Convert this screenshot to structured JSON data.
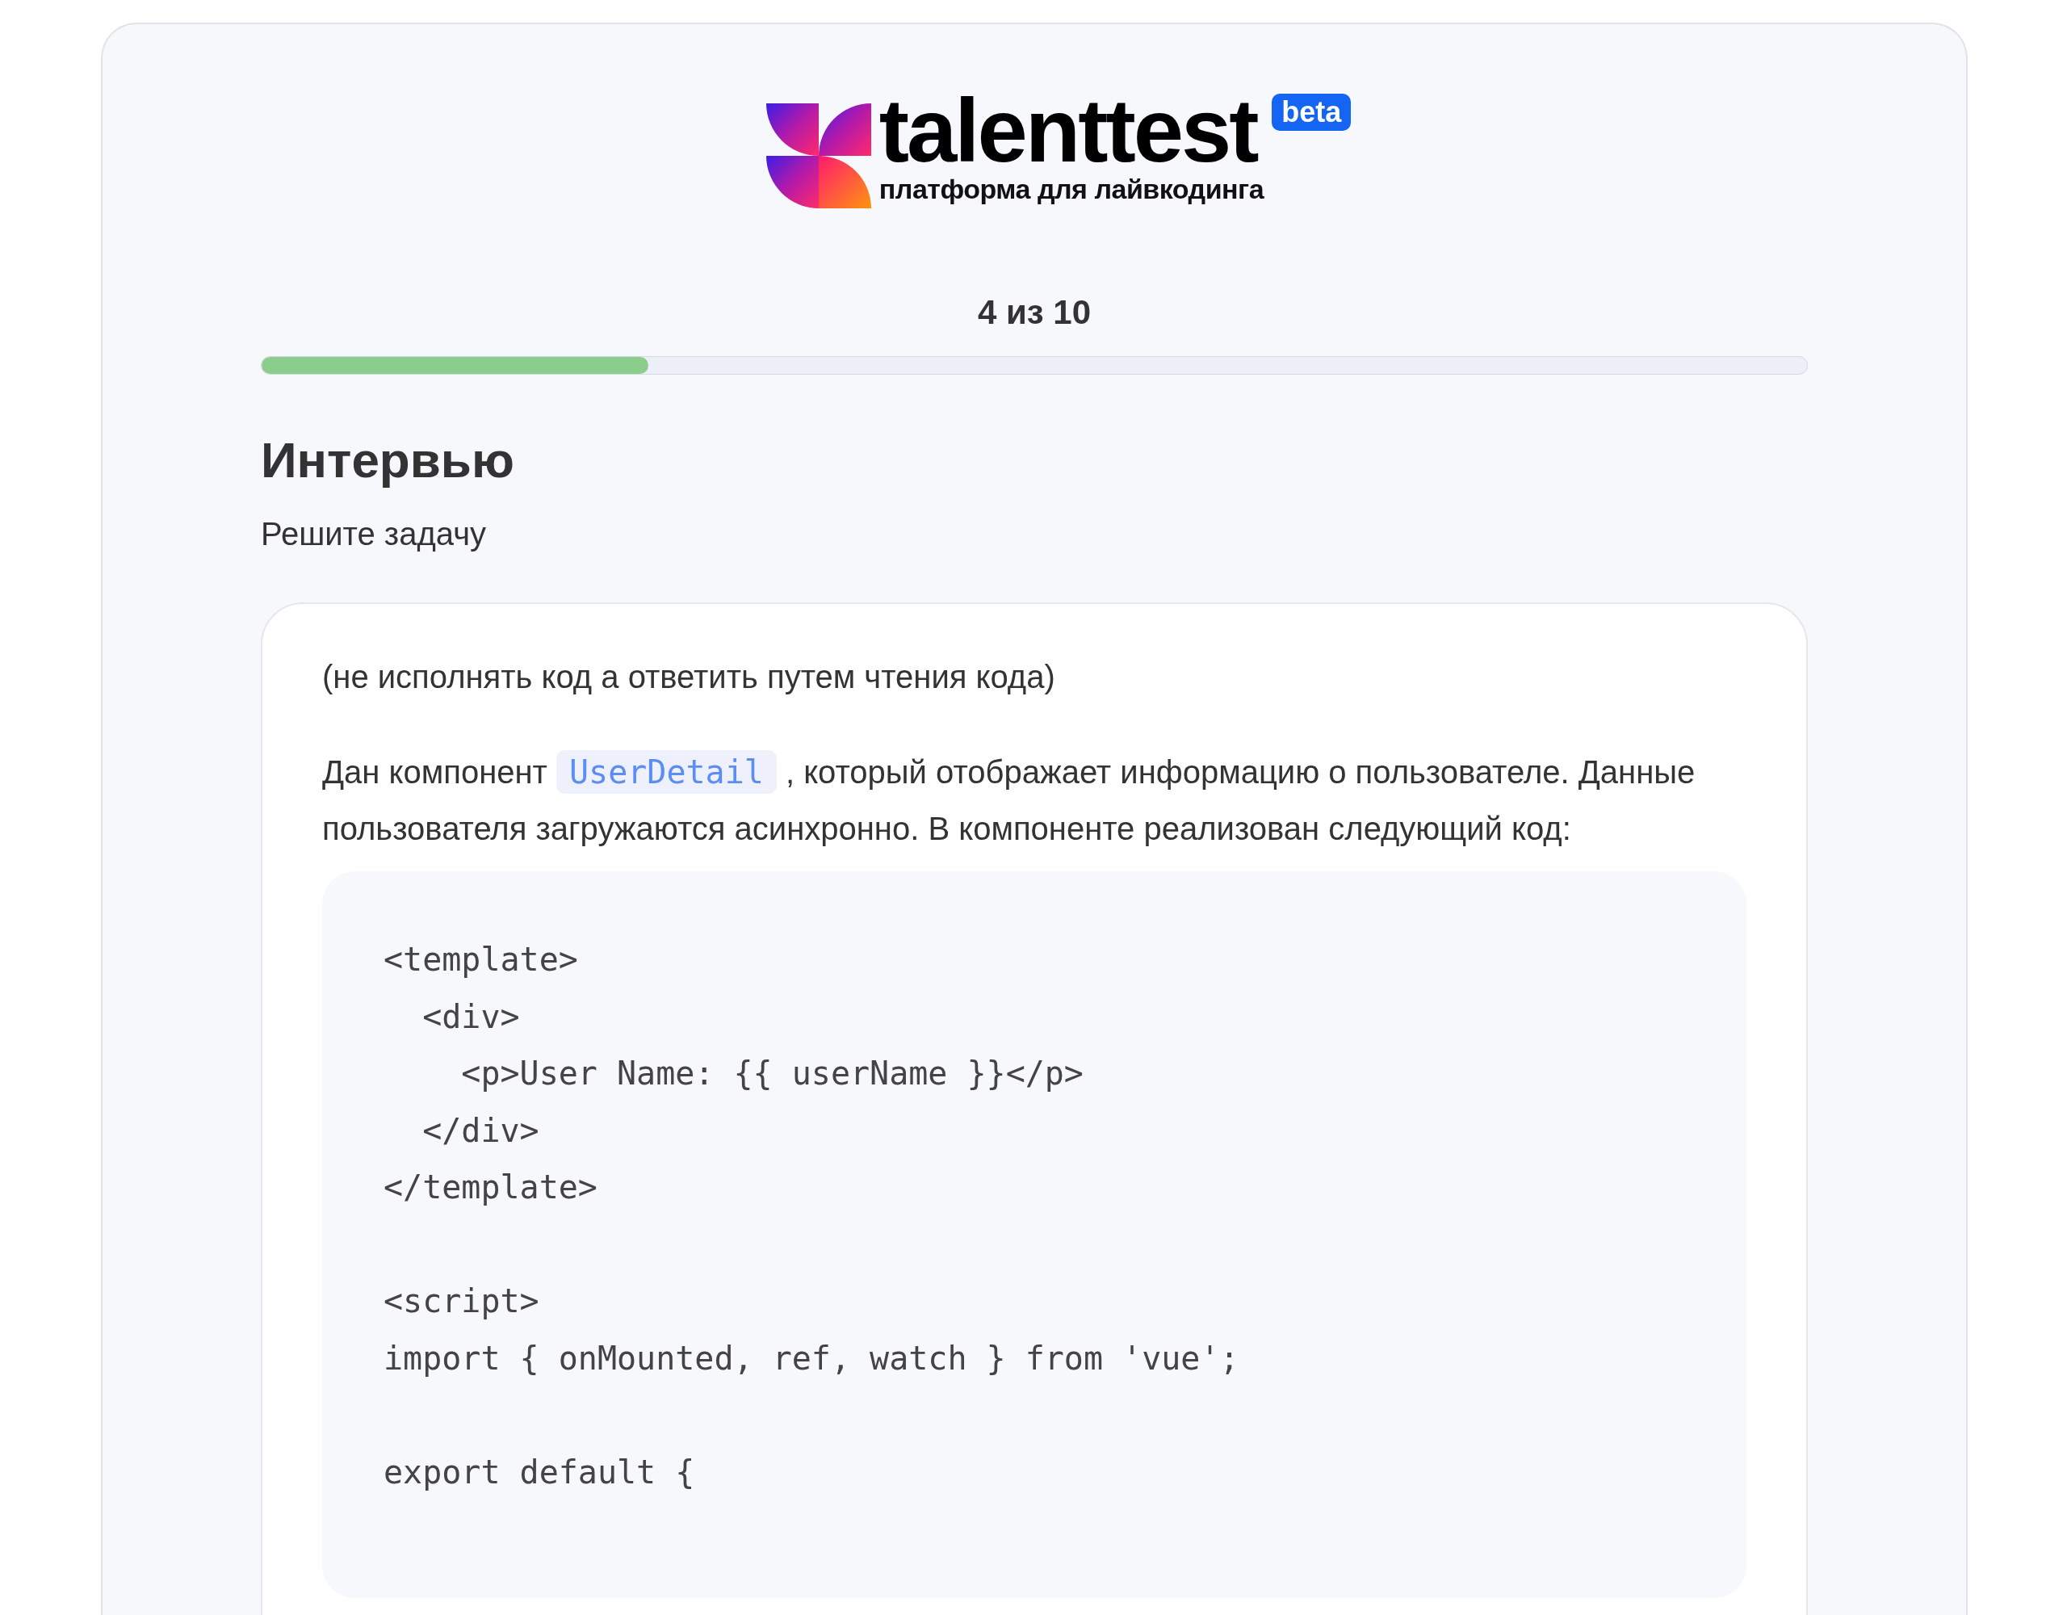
{
  "logo": {
    "name": "talenttest",
    "tagline": "платформа для лайвкодинга",
    "badge": "beta"
  },
  "progress": {
    "label": "4 из 10",
    "level": 0.25
  },
  "section": {
    "title": "Интервью",
    "subtitle": "Решите задачу"
  },
  "question": {
    "note": "(не исполнять код а ответить путем чтения кода)",
    "paragraph": [
      {
        "kind": "text",
        "text": "Дан компонент "
      },
      {
        "kind": "code",
        "text": "UserDetail"
      },
      {
        "kind": "text",
        "text": " , который отображает информацию о пользователе. Данные пользователя загружаются асинхронно. В компоненте реализован следующий код:"
      }
    ],
    "code": "<template>\n  <div>\n    <p>User Name: {{ userName }}</p>\n  </div>\n</template>\n\n<script>\nimport { onMounted, ref, watch } from 'vue';\n\nexport default {"
  }
}
